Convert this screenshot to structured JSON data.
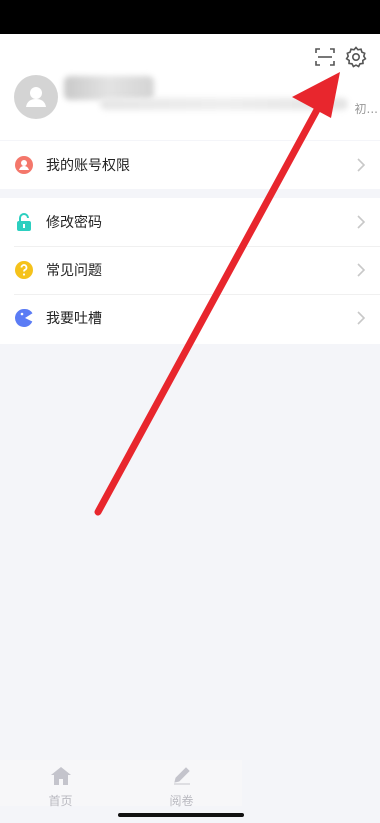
{
  "header": {
    "profile_trailing_text": "初...",
    "icons": {
      "scan": "scan-icon",
      "settings": "gear-icon",
      "avatar": "person-icon"
    }
  },
  "menu": {
    "group1": [
      {
        "label": "我的账号权限",
        "icon": "user-icon",
        "color": "#f4776b"
      }
    ],
    "group2": [
      {
        "label": "修改密码",
        "icon": "lock-icon",
        "color": "#2ccfc0"
      },
      {
        "label": "常见问题",
        "icon": "question-icon",
        "color": "#f5c21b"
      },
      {
        "label": "我要吐槽",
        "icon": "chat-icon",
        "color": "#5b7cf5"
      }
    ]
  },
  "tabs": [
    {
      "label": "首页",
      "icon": "home-icon"
    },
    {
      "label": "阅卷",
      "icon": "pencil-icon"
    }
  ],
  "colors": {
    "annotation_arrow": "#e8262d",
    "background": "#f4f5f9"
  }
}
